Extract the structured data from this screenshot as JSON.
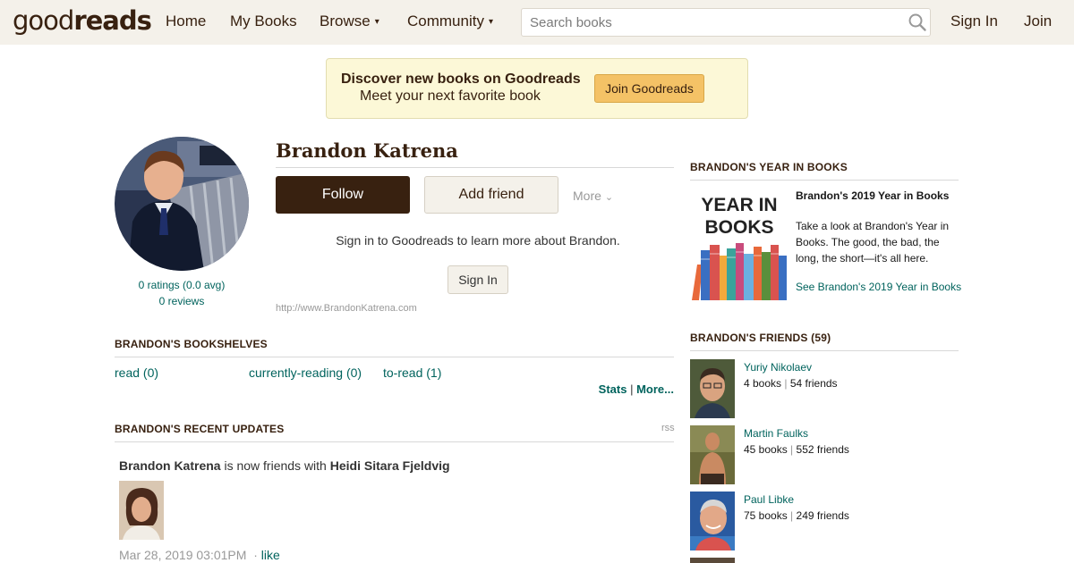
{
  "header": {
    "logo_light": "good",
    "logo_bold": "reads",
    "nav": [
      {
        "label": "Home"
      },
      {
        "label": "My Books"
      },
      {
        "label": "Browse",
        "caret": "▾"
      },
      {
        "label": "Community",
        "caret": "▾"
      }
    ],
    "search_placeholder": "Search books",
    "sign_in": "Sign In",
    "join": "Join"
  },
  "banner": {
    "title": "Discover new books on Goodreads",
    "subtitle": "Meet your next favorite book",
    "button": "Join Goodreads"
  },
  "profile": {
    "name": "Brandon Katrena",
    "ratings": "0 ratings (0.0 avg)",
    "reviews": "0 reviews",
    "follow": "Follow",
    "add_friend": "Add friend",
    "more": "More",
    "signin_prompt": "Sign in to Goodreads to learn more about Brandon.",
    "signin_button": "Sign In",
    "website": "http://www.BrandonKatrena.com"
  },
  "bookshelves": {
    "heading": "BRANDON'S BOOKSHELVES",
    "shelves": [
      {
        "label": "read (0)"
      },
      {
        "label": "currently-reading (0)"
      },
      {
        "label": "to-read (1)"
      }
    ],
    "stats": "Stats",
    "sep": "|",
    "more": "More..."
  },
  "updates": {
    "heading": "BRANDON'S RECENT UPDATES",
    "rss": "rss",
    "actor": "Brandon Katrena",
    "action": " is now friends with ",
    "target": "Heidi Sitara Fjeldvig",
    "date": "Mar 28, 2019 03:01PM",
    "like_sep": "·",
    "like": "like"
  },
  "year_in_books": {
    "heading": "BRANDON'S YEAR IN BOOKS",
    "image_line1": "YEAR IN",
    "image_line2": "BOOKS",
    "title": "Brandon's 2019 Year in Books",
    "description": "Take a look at Brandon's Year in Books. The good, the bad, the long, the short—it's all here.",
    "link": "See Brandon's 2019 Year in Books"
  },
  "friends": {
    "heading": "BRANDON'S FRIENDS (59)",
    "list": [
      {
        "name": "Yuriy Nikolaev",
        "books": "4 books",
        "friends": "54 friends"
      },
      {
        "name": "Martin Faulks",
        "books": "45 books",
        "friends": "552 friends"
      },
      {
        "name": "Paul Libke",
        "books": "75 books",
        "friends": "249 friends"
      }
    ],
    "sep": "|"
  },
  "colors": {
    "brand_brown": "#382110",
    "link_teal": "#00635d",
    "header_bg": "#f4f1ea",
    "banner_bg": "#fcf8d7",
    "join_button": "#f4c266"
  }
}
